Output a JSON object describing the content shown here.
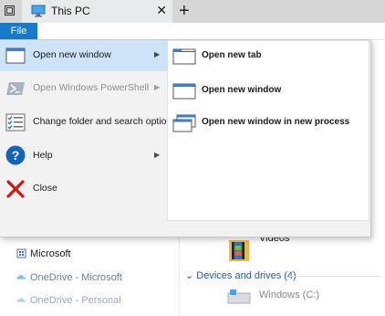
{
  "window": {
    "tab_title": "This PC",
    "tab_close_glyph": "✕",
    "new_tab_glyph": "+"
  },
  "ribbon": {
    "file_tab_label": "File"
  },
  "file_menu": {
    "items": [
      {
        "label": "Open new window",
        "icon": "window-icon",
        "has_submenu": true,
        "disabled": false,
        "highlighted": true
      },
      {
        "label": "Open Windows PowerShell",
        "icon": "powershell-icon",
        "has_submenu": true,
        "disabled": true,
        "highlighted": false
      },
      {
        "label": "Change folder and search options",
        "icon": "folder-options-icon",
        "has_submenu": false,
        "disabled": false,
        "highlighted": false
      },
      {
        "label": "Help",
        "icon": "help-icon",
        "has_submenu": true,
        "disabled": false,
        "highlighted": false
      },
      {
        "label": "Close",
        "icon": "close-x-icon",
        "has_submenu": false,
        "disabled": false,
        "highlighted": false
      }
    ],
    "submenu": [
      {
        "label": "Open new tab",
        "icon": "new-tab-icon"
      },
      {
        "label": "Open new window",
        "icon": "new-window-icon"
      },
      {
        "label": "Open new window in new process",
        "icon": "new-process-window-icon"
      }
    ],
    "submenu_arrow_glyph": "▶"
  },
  "nav_pane": {
    "items": [
      {
        "label": "Microsoft",
        "icon": "building-icon"
      },
      {
        "label": "OneDrive - Microsoft",
        "icon": "cloud-icon"
      },
      {
        "label": "OneDrive - Personal",
        "icon": "cloud-icon"
      }
    ]
  },
  "content": {
    "folder_label": "Videos",
    "section_header": "Devices and drives (4)",
    "section_chevron": "⌄",
    "drive_label": "Windows (C:)"
  },
  "colors": {
    "accent": "#1979ca",
    "menu_highlight": "#cde3f7",
    "menu_bg": "#f2f2f2",
    "close_x": "#d01717",
    "help_blue": "#1463b8"
  }
}
